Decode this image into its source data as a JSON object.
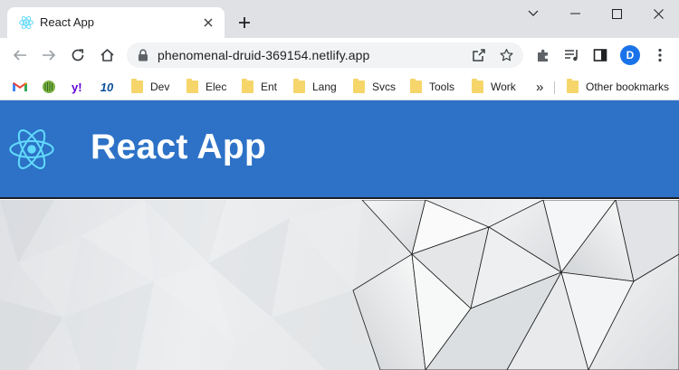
{
  "browser": {
    "tab": {
      "title": "React App"
    },
    "address_bar": {
      "url": "phenomenal-druid-369154.netlify.app"
    },
    "profile_initial": "D",
    "bookmarks": [
      {
        "label": "",
        "icon": "gmail-icon"
      },
      {
        "label": "",
        "icon": "spreadsheet-icon"
      },
      {
        "label": "",
        "icon": "yahoo-icon"
      },
      {
        "label": "",
        "icon": "ten-icon"
      },
      {
        "label": "Dev",
        "icon": "folder-icon"
      },
      {
        "label": "Elec",
        "icon": "folder-icon"
      },
      {
        "label": "Ent",
        "icon": "folder-icon"
      },
      {
        "label": "Lang",
        "icon": "folder-icon"
      },
      {
        "label": "Svcs",
        "icon": "folder-icon"
      },
      {
        "label": "Tools",
        "icon": "folder-icon"
      },
      {
        "label": "Work",
        "icon": "folder-icon"
      }
    ],
    "overflow_label": "»",
    "other_bookmarks": "Other bookmarks",
    "ten_logo_text": "10"
  },
  "page": {
    "header_title": "React App",
    "accent_color": "#2d72c7",
    "react_logo_color": "#61dafb"
  }
}
